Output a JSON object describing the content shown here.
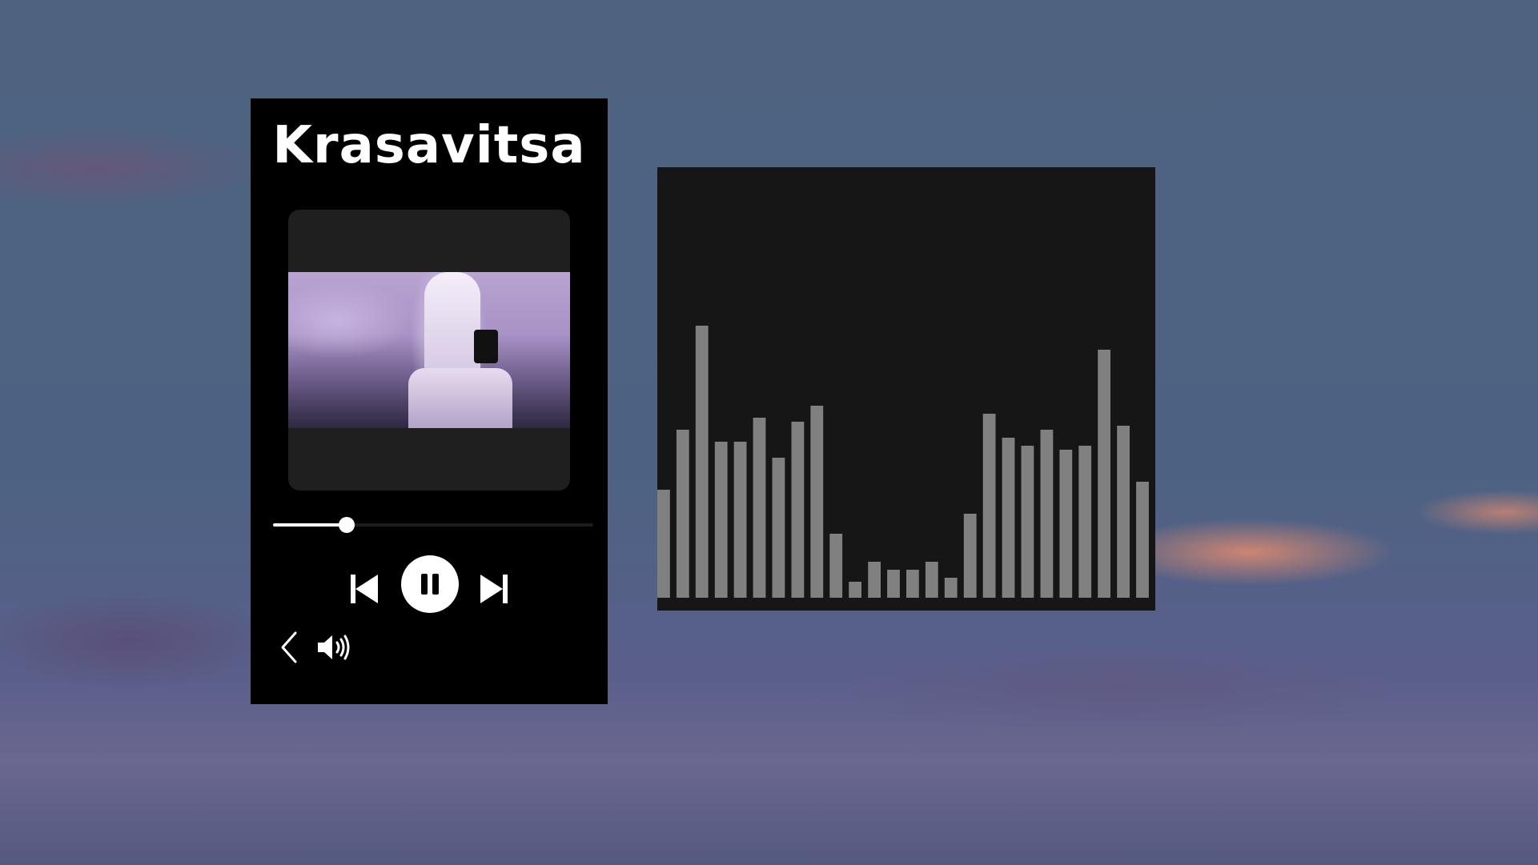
{
  "player": {
    "title": "Krasavitsa",
    "progress": 0.23
  },
  "chart_data": {
    "type": "bar",
    "values": [
      27,
      42,
      68,
      39,
      39,
      45,
      35,
      44,
      48,
      16,
      4,
      9,
      7,
      7,
      9,
      5,
      21,
      46,
      40,
      38,
      42,
      37,
      38,
      62,
      43,
      29
    ],
    "ylim": [
      0,
      100
    ],
    "grid": false,
    "bar_color": "#808080",
    "background": "#161616"
  },
  "colors": {
    "player_bg": "#000000",
    "accent": "#ffffff",
    "track": "#1c1c1c"
  },
  "icons": {
    "prev": "skip-previous-icon",
    "play_pause": "pause-icon",
    "next": "skip-next-icon",
    "back": "chevron-left-icon",
    "volume": "volume-icon"
  }
}
